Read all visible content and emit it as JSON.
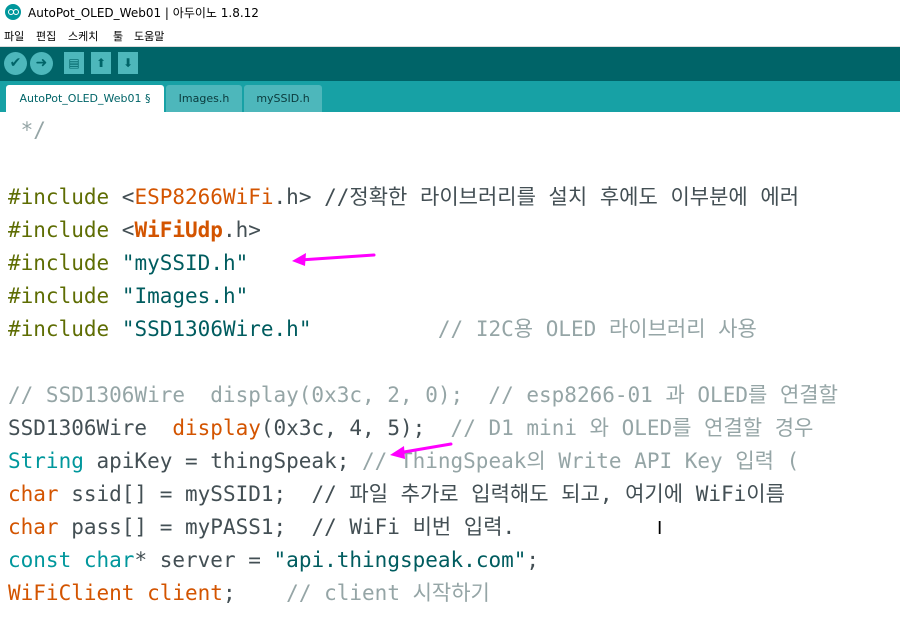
{
  "window": {
    "title": "AutoPot_OLED_Web01 | 아두이노 1.8.12"
  },
  "menu": [
    "파일",
    "편집",
    "스케치",
    "툴",
    "도움말"
  ],
  "toolbar": {
    "verify_icon": "✔",
    "upload_icon": "➜",
    "new_icon": "▤",
    "open_icon": "⬆",
    "save_icon": "⬇"
  },
  "tabs": [
    {
      "label": "AutoPot_OLED_Web01 §",
      "active": true
    },
    {
      "label": "Images.h",
      "active": false
    },
    {
      "label": "mySSID.h",
      "active": false
    }
  ],
  "code": {
    "l0": {
      "text": " */"
    },
    "l2": {
      "pre": "#include",
      "sp": " <",
      "lib": "ESP8266WiFi",
      "rest": ".h> ",
      "cmt": "//정확한 라이브러리를 설치 후에도 이부분에 에러"
    },
    "l3": {
      "pre": "#include",
      "sp": " <",
      "lib": "WiFiUdp",
      "rest": ".h>"
    },
    "l4": {
      "pre": "#include",
      "sp": " ",
      "str": "\"mySSID.h\""
    },
    "l5": {
      "pre": "#include",
      "sp": " ",
      "str": "\"Images.h\""
    },
    "l6": {
      "pre": "#include",
      "sp": " ",
      "str": "\"SSD1306Wire.h\"",
      "gap": "          ",
      "cmt": "// I2C용 OLED 라이브러리 사용"
    },
    "l8": {
      "cmt": "// SSD1306Wire  display(0x3c, 2, 0);  // esp8266-01 과 OLED를 연결할"
    },
    "l9": {
      "plain1": "SSD1306Wire  ",
      "fn": "display",
      "plain2": "(0x3c, 4, 5);  ",
      "cmt": "// D1 mini 와 OLED를 연결할 경우"
    },
    "l10": {
      "type": "String",
      "plain": " apiKey = thingSpeak; ",
      "cmt": "// ThingSpeak의 Write API Key 입력 ("
    },
    "l11": {
      "type": "char",
      "plain": " ssid[] = mySSID1;  ",
      "cmt": "// 파일 추가로 입력해도 되고, 여기에 WiFi이름"
    },
    "l12": {
      "type": "char",
      "plain": " pass[] = myPASS1;  ",
      "cmt": "// WiFi 비번 입력."
    },
    "l13": {
      "type1": "const",
      "sp": " ",
      "type2": "char",
      "plain": "* server = ",
      "str": "\"api.thingspeak.com\"",
      "end": ";"
    },
    "l14": {
      "lib1": "WiFiClient",
      "sp": " ",
      "lib2": "client",
      "plain": ";    ",
      "cmt": "// client 시작하기"
    }
  },
  "annotations": {
    "arrow_color": "#ff00ff"
  }
}
